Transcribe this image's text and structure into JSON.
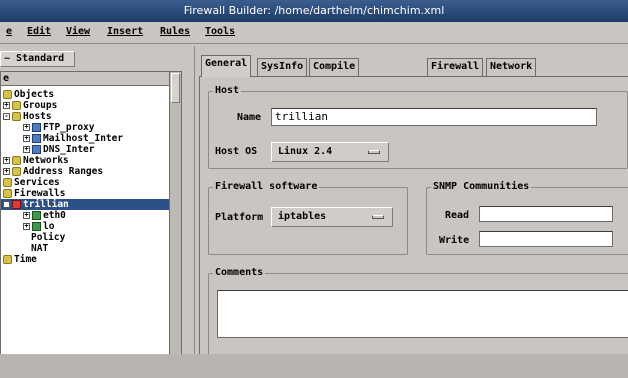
{
  "window": {
    "title": "Firewall Builder: /home/darthelm/chimchim.xml"
  },
  "menu": {
    "items": [
      "e",
      "Edit",
      "View",
      "Insert",
      "Rules",
      "Tools"
    ]
  },
  "left": {
    "library": "~ Standard",
    "tree_header": "e",
    "tree": [
      {
        "label": "Objects",
        "icon": "folder"
      },
      {
        "label": "Groups",
        "icon": "folder"
      },
      {
        "label": "Hosts",
        "icon": "folder"
      },
      {
        "label": "FTP_proxy",
        "icon": "host"
      },
      {
        "label": "Mailhost_Inter",
        "icon": "host"
      },
      {
        "label": "DNS_Inter",
        "icon": "host"
      },
      {
        "label": "Networks",
        "icon": "folder"
      },
      {
        "label": "Address Ranges",
        "icon": "folder"
      },
      {
        "label": "Services",
        "icon": "folder"
      },
      {
        "label": "Firewalls",
        "icon": "folder"
      },
      {
        "label": "trillian",
        "icon": "firewall"
      },
      {
        "label": "eth0",
        "icon": "interface"
      },
      {
        "label": "lo",
        "icon": "interface"
      },
      {
        "label": "Policy",
        "icon": "none"
      },
      {
        "label": "NAT",
        "icon": "none"
      },
      {
        "label": "Time",
        "icon": "folder"
      }
    ]
  },
  "tabs": [
    "General",
    "SysInfo",
    "Compile / Install",
    "Firewall",
    "Network"
  ],
  "host": {
    "group_title": "Host",
    "name_label": "Name",
    "name_value": "trillian",
    "os_label": "Host OS",
    "os_value": "Linux 2.4"
  },
  "firewall_software": {
    "group_title": "Firewall software",
    "platform_label": "Platform",
    "platform_value": "iptables"
  },
  "snmp": {
    "group_title": "SNMP Communities",
    "read_label": "Read",
    "read_value": "",
    "write_label": "Write",
    "write_value": ""
  },
  "comments": {
    "group_title": "Comments",
    "value": ""
  },
  "colors": {
    "titlebar": "#1e3a66",
    "selection": "#2b4f86",
    "background": "#c9c5c1"
  }
}
